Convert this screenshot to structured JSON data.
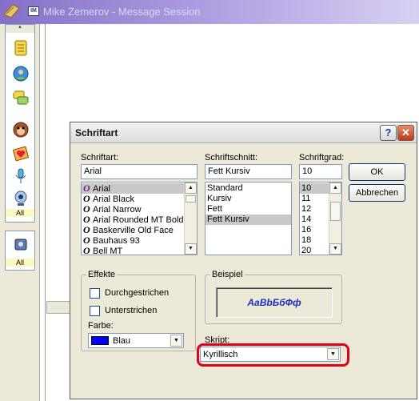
{
  "window": {
    "title": "Mike Zemerov - Message Session",
    "mini_icon_text": "IM",
    "sidebar_all_1": "All",
    "sidebar_all_2": "All"
  },
  "dialog": {
    "title": "Schriftart",
    "help_label": "?",
    "close_label": "✕",
    "font": {
      "label": "Schriftart:",
      "value": "Arial",
      "items": [
        "Arial",
        "Arial Black",
        "Arial Narrow",
        "Arial Rounded MT Bold",
        "Baskerville Old Face",
        "Bauhaus 93",
        "Bell MT"
      ],
      "glyph": "O"
    },
    "style": {
      "label": "Schriftschnitt:",
      "value": "Fett Kursiv",
      "items": [
        "Standard",
        "Kursiv",
        "Fett",
        "Fett Kursiv"
      ]
    },
    "size": {
      "label": "Schriftgrad:",
      "value": "10",
      "items": [
        "10",
        "11",
        "12",
        "14",
        "16",
        "18",
        "20"
      ]
    },
    "ok_label": "OK",
    "cancel_label": "Abbrechen",
    "effects": {
      "label": "Effekte",
      "strikeout": "Durchgestrichen",
      "underline": "Unterstrichen",
      "color_label": "Farbe:",
      "color_value": "Blau",
      "color_hex": "#0000ff"
    },
    "sample": {
      "label": "Beispiel",
      "text": "AaBbБбФф"
    },
    "script": {
      "label": "Skript:",
      "value": "Kyrillisch"
    },
    "highlight_color": "#e0001a"
  }
}
